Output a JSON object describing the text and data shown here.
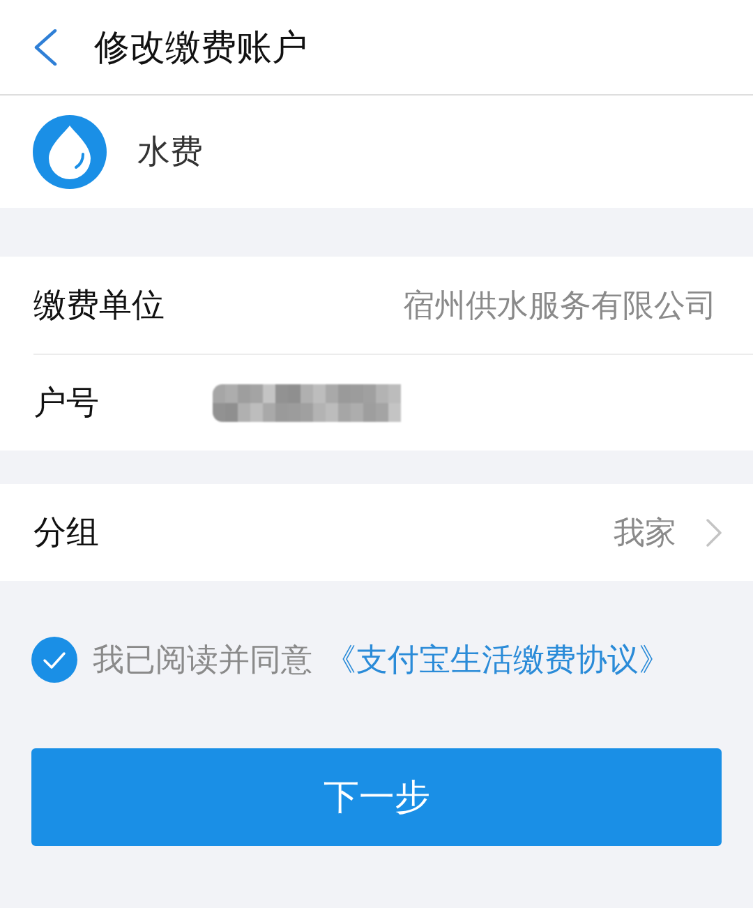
{
  "header": {
    "title": "修改缴费账户"
  },
  "service": {
    "name": "水费"
  },
  "fields": [
    {
      "kind": "text",
      "label": "缴费单位",
      "value": "宿州供水服务有限公司"
    },
    {
      "kind": "redacted",
      "label": "户号"
    }
  ],
  "group": {
    "label": "分组",
    "value": "我家"
  },
  "agreement": {
    "checked": true,
    "text": "我已阅读并同意",
    "link": "《支付宝生活缴费协议》"
  },
  "primary_button": {
    "label": "下一步"
  }
}
